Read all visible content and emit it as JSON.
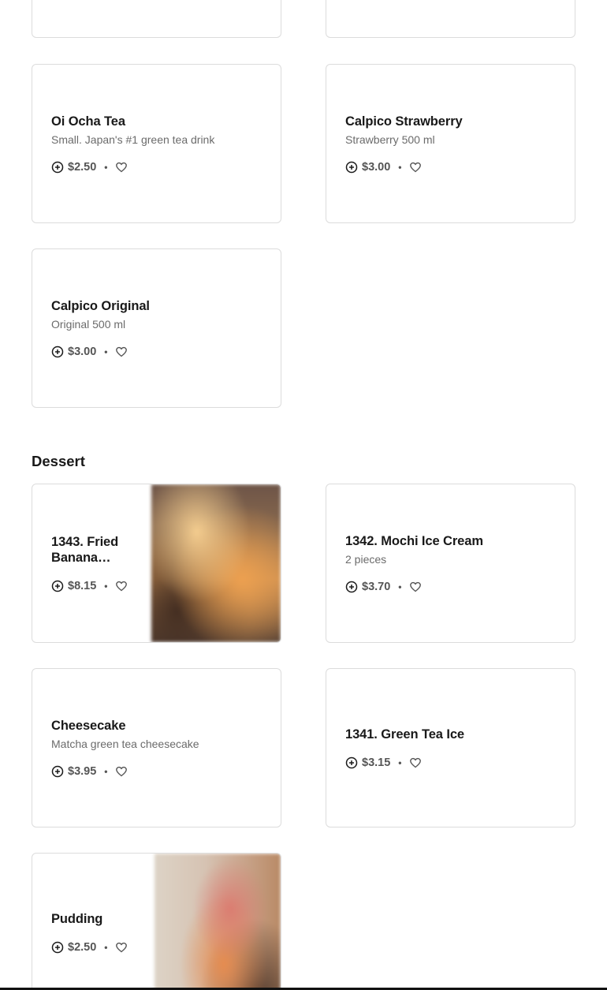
{
  "drinks": {
    "items": [
      {
        "title": "Oi Ocha Tea",
        "description": "Small. Japan's #1 green tea drink",
        "price": "$2.50"
      },
      {
        "title": "Calpico Strawberry",
        "description": "Strawberry 500 ml",
        "price": "$3.00"
      },
      {
        "title": "Calpico Original",
        "description": "Original 500 ml",
        "price": "$3.00"
      }
    ]
  },
  "dessert": {
    "section_title": "Dessert",
    "items": [
      {
        "title": "1343. Fried Banana…",
        "description": "",
        "price": "$8.15",
        "image": "fried-banana-photo"
      },
      {
        "title": "1342. Mochi Ice Cream",
        "description": "2 pieces",
        "price": "$3.70"
      },
      {
        "title": "Cheesecake",
        "description": "Matcha green tea cheesecake",
        "price": "$3.95"
      },
      {
        "title": "1341. Green Tea Ice",
        "description": "",
        "price": "$3.15"
      },
      {
        "title": "Pudding",
        "description": "",
        "price": "$2.50",
        "image": "pudding-photo"
      }
    ]
  },
  "icons": {
    "add": "add-circle-icon",
    "favorite": "heart-icon"
  },
  "separator": "•"
}
